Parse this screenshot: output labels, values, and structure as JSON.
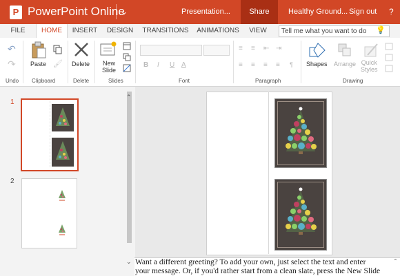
{
  "app": {
    "logo_letter": "P",
    "name": "PowerPoint Online",
    "document": "Presentation...",
    "share_label": "Share",
    "site": "Healthy Ground...",
    "signout_label": "Sign out",
    "help_label": "?"
  },
  "tabs": [
    "FILE",
    "HOME",
    "INSERT",
    "DESIGN",
    "TRANSITIONS",
    "ANIMATIONS",
    "VIEW"
  ],
  "tell_me_placeholder": "Tell me what you want to do",
  "ribbon": {
    "groups": {
      "undo": "Undo",
      "clipboard": "Clipboard",
      "delete": "Delete",
      "slides": "Slides",
      "font": "Font",
      "paragraph": "Paragraph",
      "drawing": "Drawing"
    },
    "paste_label": "Paste",
    "delete_label": "Delete",
    "new_slide_label_1": "New",
    "new_slide_label_2": "Slide",
    "shapes_label": "Shapes",
    "arrange_label": "Arrange",
    "quick_styles_label_1": "Quick",
    "quick_styles_label_2": "Styles",
    "bold": "B",
    "italic": "I",
    "underline": "U",
    "font_color": "A"
  },
  "slides": {
    "numbers": [
      "1",
      "2"
    ]
  },
  "notes": {
    "line1": "Want a different greeting? To add your own, just select the text and enter",
    "line2": "your message. Or, if you'd rather start from a clean slate, press the New Slide"
  },
  "colors": {
    "brand": "#d24726",
    "share_bg": "#a92f14",
    "card_bg": "#4a4340"
  }
}
